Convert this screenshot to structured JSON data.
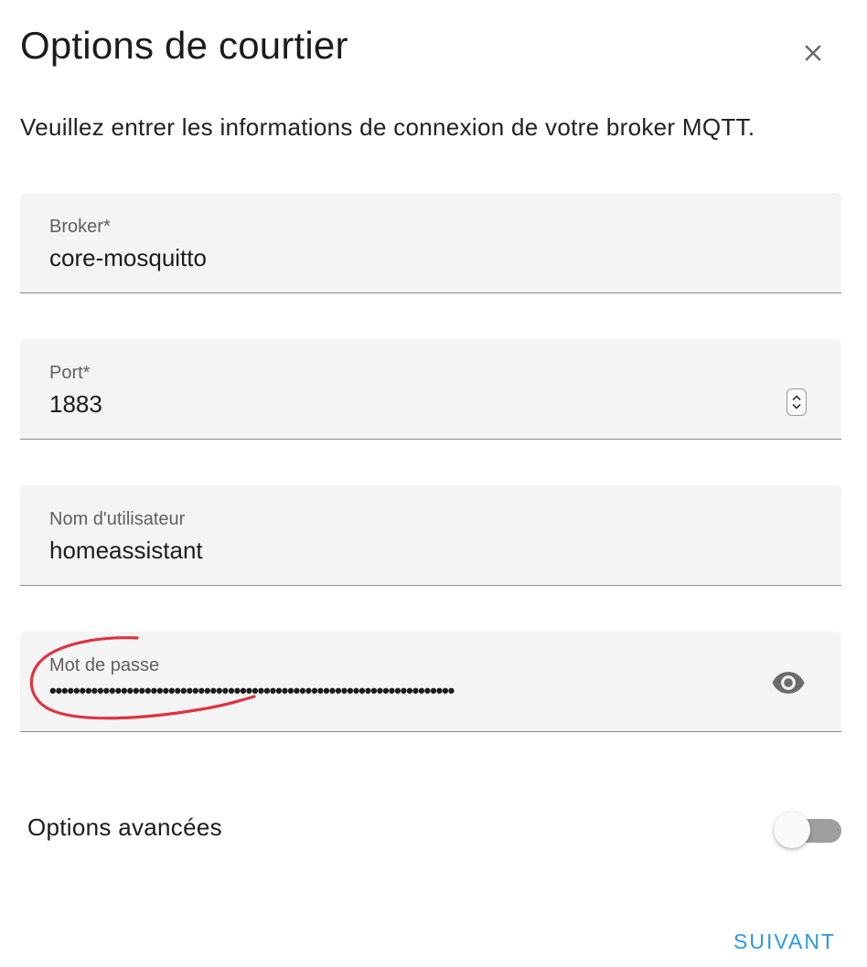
{
  "dialog": {
    "title": "Options de courtier",
    "close_icon": "close-icon",
    "description": "Veuillez entrer les informations de connexion de votre broker MQTT."
  },
  "fields": {
    "broker": {
      "label": "Broker*",
      "value": "core-mosquitto"
    },
    "port": {
      "label": "Port*",
      "value": "1883",
      "icon": "stepper-icon"
    },
    "username": {
      "label": "Nom d'utilisateur",
      "value": "homeassistant"
    },
    "password": {
      "label": "Mot de passe",
      "masked_value": "••••••••••••••••••••••••••••••••••••••••••••••••••••••••••••••••••••",
      "icon": "eye-icon"
    }
  },
  "advanced": {
    "label": "Options avancées",
    "enabled": false
  },
  "actions": {
    "next_label": "SUIVANT"
  },
  "colors": {
    "accent": "#2a98e6",
    "field_background": "#f4f4f4",
    "annotation": "#e0323e",
    "toggle_off_track": "#9e9e9e"
  }
}
